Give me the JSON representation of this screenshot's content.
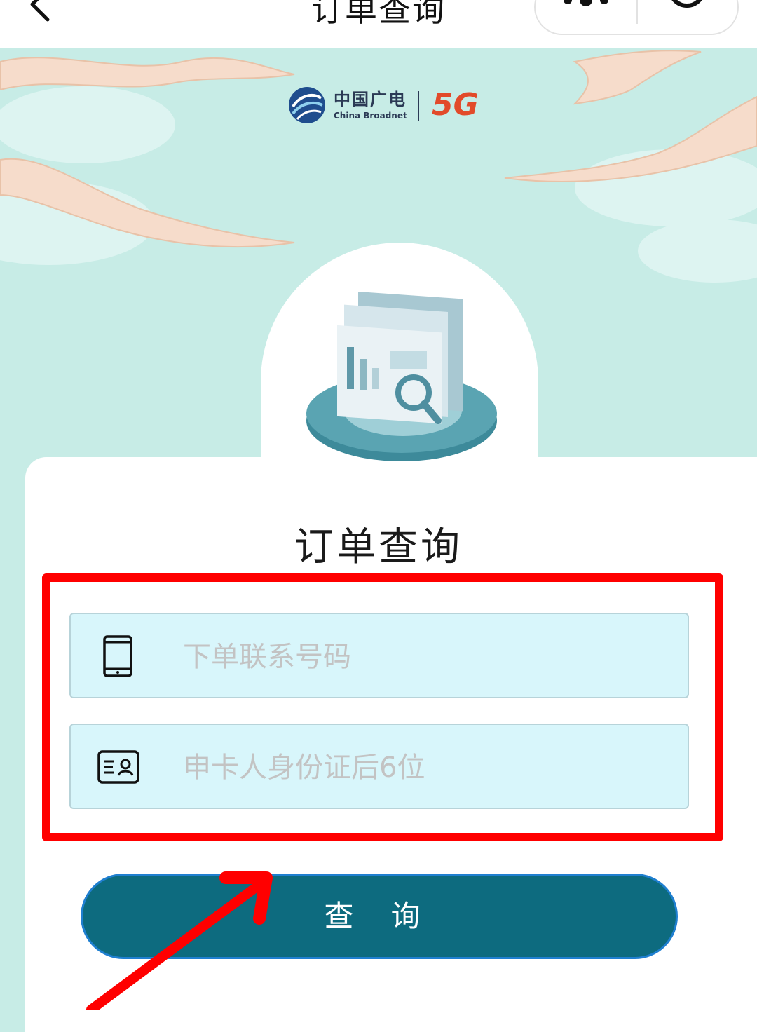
{
  "nav": {
    "title": "订单查询",
    "back_icon": "chevron-left-icon",
    "more_icon": "more-dots-icon",
    "close_icon": "target-circle-icon"
  },
  "brand": {
    "name_cn": "中国广电",
    "name_en": "China Broadnet",
    "badge": "5G"
  },
  "form": {
    "title": "订单查询",
    "phone_placeholder": "下单联系号码",
    "phone_value": "",
    "id_placeholder": "申卡人身份证后6位",
    "id_value": "",
    "submit_label": "查 询"
  },
  "colors": {
    "background": "#c7ece6",
    "field_bg": "#d8f6fb",
    "button_bg": "#0d6b7f",
    "highlight": "#ff0000",
    "logo_5g": "#e24a2a"
  }
}
